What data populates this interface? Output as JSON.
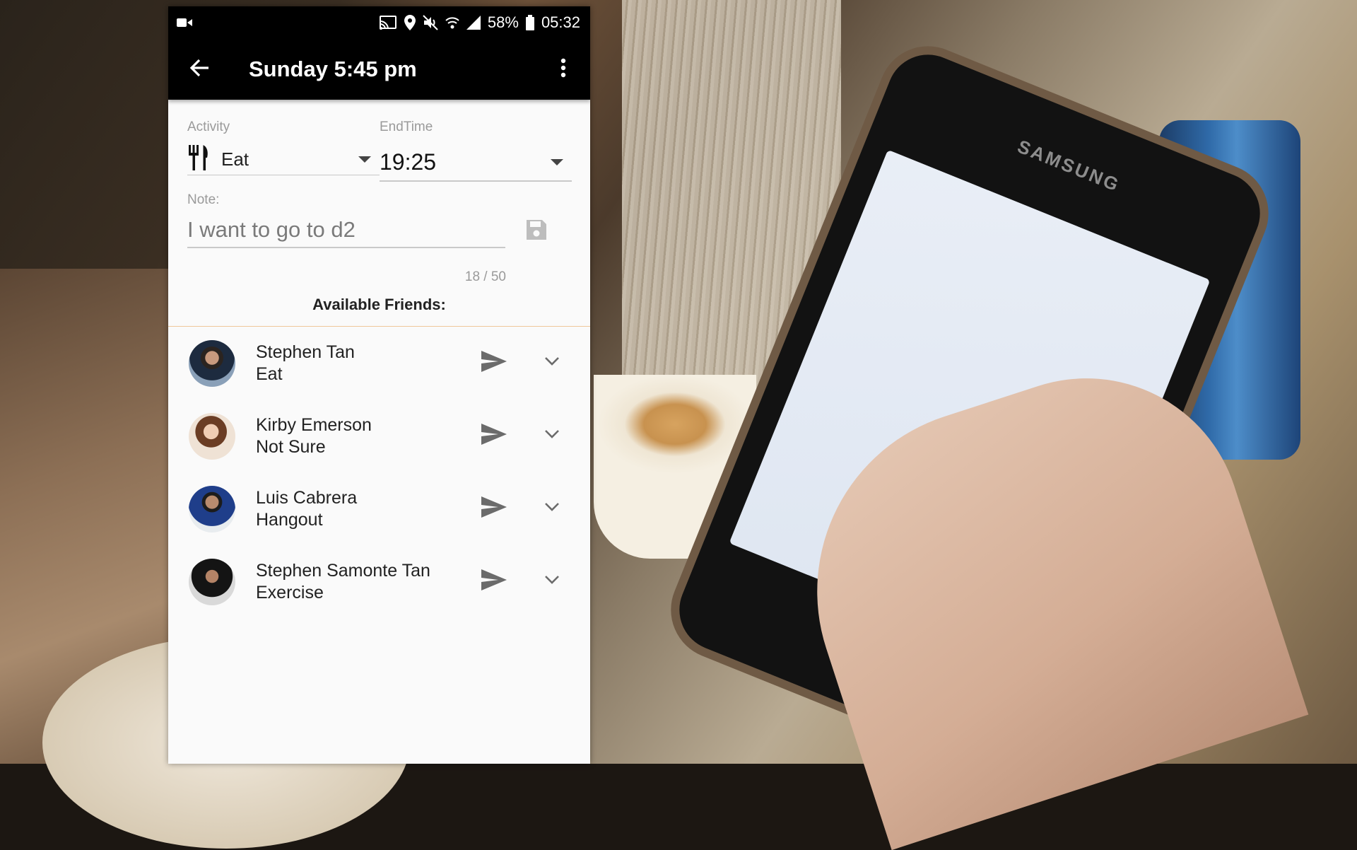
{
  "status_bar": {
    "battery": "58%",
    "time": "05:32",
    "icons": [
      "video-icon",
      "cast-icon",
      "location-icon",
      "mute-icon",
      "wifi-icon",
      "signal-icon",
      "battery-icon"
    ]
  },
  "app_bar": {
    "title": "Sunday 5:45 pm",
    "icons": [
      "back-arrow-icon",
      "more-vert-icon"
    ]
  },
  "form": {
    "activity_label": "Activity",
    "activity_value": "Eat",
    "activity_icon": "fork-knife-icon",
    "endtime_label": "EndTime",
    "endtime_value": "19:25",
    "note_label": "Note:",
    "note_value": "I want to go to d2",
    "note_counter": "18 / 50",
    "save_icon": "save-icon"
  },
  "friends_heading": "Available Friends:",
  "friends": [
    {
      "name": "Stephen Tan",
      "activity": "Eat"
    },
    {
      "name": "Kirby Emerson",
      "activity": "Not Sure"
    },
    {
      "name": "Luis Cabrera",
      "activity": "Hangout"
    },
    {
      "name": "Stephen Samonte Tan",
      "activity": "Exercise"
    }
  ],
  "background_photo": {
    "phone_brand": "SAMSUNG"
  },
  "colors": {
    "app_bar": "#000000",
    "surface": "#fafafa",
    "divider_accent": "#f0c79a",
    "icon_gray": "#6b6b6b"
  }
}
